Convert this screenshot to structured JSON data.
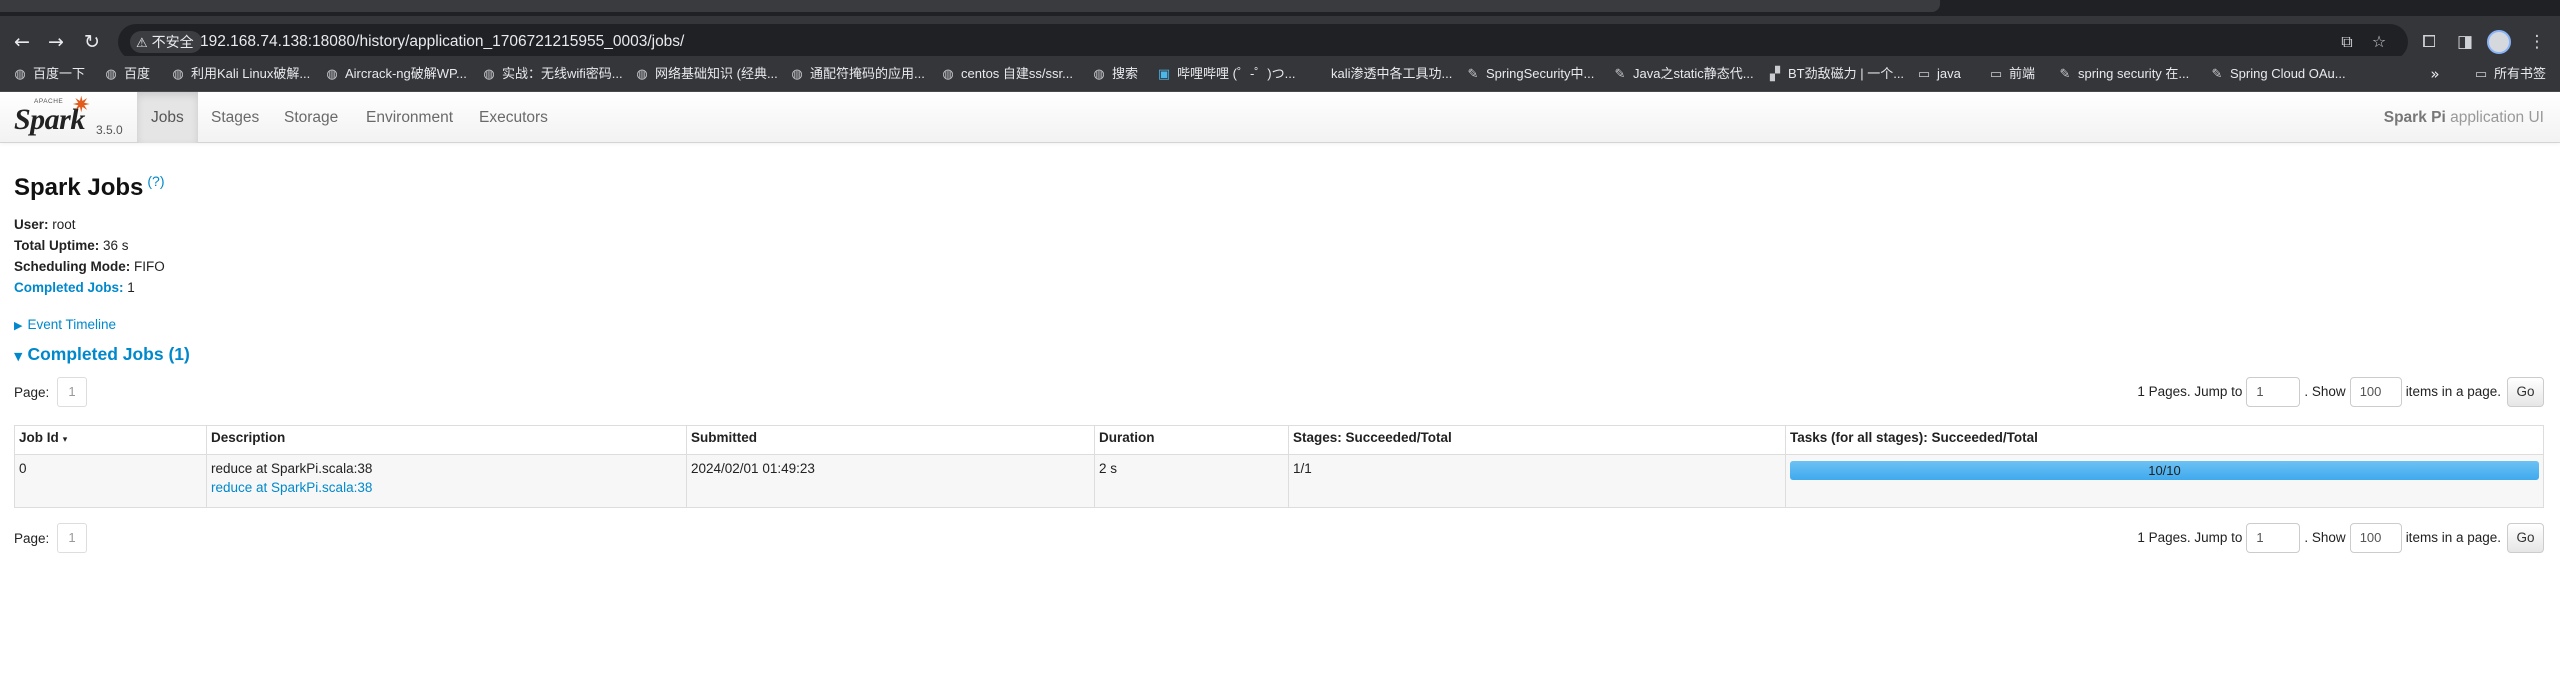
{
  "browser": {
    "security_label": "不安全",
    "url": "192.168.74.138:18080/history/application_1706721215955_0003/jobs/",
    "bookmarks": [
      {
        "label": "百度一下",
        "icon": "globe-icon"
      },
      {
        "label": "百度",
        "icon": "globe-icon"
      },
      {
        "label": "利用Kali Linux破解...",
        "icon": "globe-icon"
      },
      {
        "label": "Aircrack-ng破解WP...",
        "icon": "globe-icon"
      },
      {
        "label": "实战：无线wifi密码...",
        "icon": "globe-icon"
      },
      {
        "label": "网络基础知识 (经典...",
        "icon": "globe-icon"
      },
      {
        "label": "通配符掩码的应用...",
        "icon": "globe-icon"
      },
      {
        "label": "centos 自建ss/ssr...",
        "icon": "globe-icon"
      },
      {
        "label": "搜索",
        "icon": "globe-icon"
      },
      {
        "label": "哔哩哔哩 (゜-゜)つ...",
        "icon": "bilibili-icon"
      },
      {
        "label": "kali渗透中各工具功...",
        "icon": "blank-icon"
      },
      {
        "label": "SpringSecurity中...",
        "icon": "site-icon"
      },
      {
        "label": "Java之static静态代...",
        "icon": "site-icon"
      },
      {
        "label": "BT劲敌磁力 | 一个...",
        "icon": "site-icon"
      },
      {
        "label": "java",
        "icon": "folder-icon"
      },
      {
        "label": "前端",
        "icon": "folder-icon"
      },
      {
        "label": "spring security 在...",
        "icon": "site-icon"
      },
      {
        "label": "Spring Cloud OAu...",
        "icon": "site-icon"
      }
    ],
    "all_bookmarks_label": "所有书签"
  },
  "navbar": {
    "brand_word": "Spark",
    "brand_apache": "APACHE",
    "version": "3.5.0",
    "tabs": [
      "Jobs",
      "Stages",
      "Storage",
      "Environment",
      "Executors"
    ],
    "active_tab": "Jobs",
    "app_name_bold": "Spark Pi",
    "app_name_rest": " application UI"
  },
  "page": {
    "title": "Spark Jobs",
    "help": "(?)",
    "user_label": "User:",
    "user_value": " root",
    "uptime_label": "Total Uptime:",
    "uptime_value": " 36 s",
    "mode_label": "Scheduling Mode:",
    "mode_value": " FIFO",
    "completed_label": "Completed Jobs:",
    "completed_value": " 1",
    "event_timeline": "Event Timeline",
    "completed_section": "Completed Jobs (1)"
  },
  "pagination": {
    "page_label": "Page:",
    "current_page": "1",
    "pages_text": "1 Pages. Jump to",
    "jump_value": "1",
    "show_text": ". Show",
    "show_value": "100",
    "items_text": "items in a page.",
    "go_label": "Go"
  },
  "jobs_table": {
    "columns": [
      "Job Id",
      "Description",
      "Submitted",
      "Duration",
      "Stages: Succeeded/Total",
      "Tasks (for all stages): Succeeded/Total"
    ],
    "sort_indicator": "▾",
    "rows": [
      {
        "job_id": "0",
        "description": "reduce at SparkPi.scala:38",
        "description_link": "reduce at SparkPi.scala:38",
        "submitted": "2024/02/01 01:49:23",
        "duration": "2 s",
        "stages": "1/1",
        "tasks": "10/10",
        "tasks_fraction": 1.0
      }
    ]
  },
  "colors": {
    "link": "#0088cc",
    "progress_bar": "#3fa9ee",
    "spark_orange": "#e25a1c"
  }
}
